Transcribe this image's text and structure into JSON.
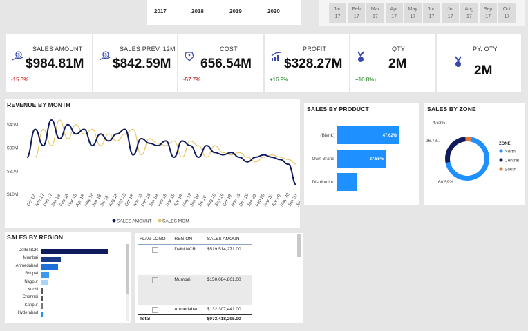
{
  "years": [
    "2017",
    "2018",
    "2019",
    "2020"
  ],
  "months": [
    {
      "m": "Jan",
      "y": "17"
    },
    {
      "m": "Feb",
      "y": "17"
    },
    {
      "m": "Mar",
      "y": "17"
    },
    {
      "m": "Apr",
      "y": "17"
    },
    {
      "m": "May",
      "y": "17"
    },
    {
      "m": "Jun",
      "y": "17"
    },
    {
      "m": "Jul",
      "y": "17"
    },
    {
      "m": "Aug",
      "y": "17"
    },
    {
      "m": "Sep",
      "y": "17"
    },
    {
      "m": "Oct",
      "y": "17"
    }
  ],
  "kpis": [
    {
      "label": "SALES AMOUNT",
      "value": "$984.81M",
      "change": "-15.3%↓",
      "icon": "money-hand-icon"
    },
    {
      "label": "SALES PREV. 12M",
      "value": "$842.59M",
      "change": "",
      "icon": "money-hand-icon"
    },
    {
      "label": "COST",
      "value": "656.54M",
      "change": "-57.7%↓",
      "icon": "tag-icon"
    },
    {
      "label": "PROFIT",
      "value": "$328.27M",
      "change": "+16.9%↑",
      "icon": "growth-chart-icon"
    },
    {
      "label": "QTY",
      "value": "2M",
      "change": "+16.8%↑",
      "icon": "medal-icon"
    },
    {
      "label": "PY. QTY",
      "value": "2M",
      "change": "",
      "icon": "medal-icon"
    }
  ],
  "colors": {
    "navy": "#0f1b5c",
    "gold": "#e8c766",
    "blue": "#1e90ff",
    "orange": "#e07a3c"
  },
  "revenue": {
    "title": "REVENUE BY MONTH",
    "legend": [
      "SALES AMOUNT",
      "SALES MOM"
    ],
    "y_ticks": [
      "$40M",
      "$30M",
      "$20M",
      "$10M"
    ],
    "x_labels": [
      "Oct 17",
      "Nov 17",
      "Dec 17",
      "Jan 18",
      "Feb 18",
      "Mar 18",
      "Apr 18",
      "May 18",
      "Jun 18",
      "Jul 18",
      "Aug 18",
      "Sep 18",
      "Oct 18",
      "Nov 18",
      "Dec 18",
      "Jan 19",
      "Feb 19",
      "Mar 19",
      "Apr 19",
      "May 19",
      "Jun 19",
      "Jul 19",
      "Aug 19",
      "Sep 19",
      "Oct 19",
      "Nov 19",
      "Dec 19",
      "Jan 20",
      "Feb 20",
      "Mar 20",
      "Apr 20",
      "May 20",
      "Jun 20",
      "Jul 20"
    ]
  },
  "chart_data": [
    {
      "type": "line",
      "title": "REVENUE BY MONTH",
      "x": [
        "Oct 17",
        "Nov 17",
        "Dec 17",
        "Jan 18",
        "Feb 18",
        "Mar 18",
        "Apr 18",
        "May 18",
        "Jun 18",
        "Jul 18",
        "Aug 18",
        "Sep 18",
        "Oct 18",
        "Nov 18",
        "Dec 18",
        "Jan 19",
        "Feb 19",
        "Mar 19",
        "Apr 19",
        "May 19",
        "Jun 19",
        "Jul 19",
        "Aug 19",
        "Sep 19",
        "Oct 19",
        "Nov 19",
        "Dec 19",
        "Jan 20",
        "Feb 20",
        "Mar 20",
        "Apr 20",
        "May 20",
        "Jun 20",
        "Jul 20"
      ],
      "series": [
        {
          "name": "SALES AMOUNT",
          "values": [
            26,
            38,
            31,
            42,
            34,
            40,
            36,
            38,
            31,
            36,
            33,
            36,
            38,
            27,
            34,
            32,
            31,
            33,
            26,
            33,
            31,
            26,
            31,
            28,
            27,
            28,
            26,
            24,
            26,
            27,
            26,
            25,
            23,
            14
          ]
        },
        {
          "name": "SALES MOM",
          "values": [
            null,
            26,
            38,
            31,
            42,
            34,
            40,
            36,
            38,
            31,
            36,
            33,
            36,
            38,
            27,
            34,
            32,
            31,
            33,
            26,
            33,
            31,
            26,
            31,
            28,
            27,
            28,
            26,
            24,
            26,
            27,
            26,
            25,
            23
          ]
        }
      ],
      "ylim": [
        10,
        45
      ],
      "legend": "bottom"
    },
    {
      "type": "bar",
      "title": "SALES BY PRODUCT",
      "categories": [
        "(Blank)",
        "Own Brand",
        "Distribution"
      ],
      "values": [
        47.62,
        37.55,
        14.83
      ],
      "labels": [
        "47.62%",
        "37.55%",
        ""
      ]
    },
    {
      "type": "pie",
      "title": "SALES BY ZONE",
      "legend_title": "ZONE",
      "categories": [
        "North",
        "Central",
        "South"
      ],
      "values": [
        68.59,
        26.78,
        4.63
      ],
      "labels": [
        "68.59%",
        "26.78...",
        "4.63%"
      ]
    },
    {
      "type": "bar",
      "title": "SALES BY REGION",
      "categories": [
        "Delhi NCR",
        "Mumbai",
        "Ahmedabad",
        "Bhopal",
        "Nagpur",
        "Kochi",
        "Chennai",
        "Kanpur",
        "Hyderabad"
      ],
      "values": [
        519.5,
        150.1,
        132.3,
        60,
        55,
        12,
        10,
        5,
        4
      ]
    }
  ],
  "product": {
    "title": "SALES BY PRODUCT",
    "rows": [
      {
        "label": "(Blank)",
        "value": 47.62,
        "text": "47.62%"
      },
      {
        "label": "Own Brand",
        "value": 37.55,
        "text": "37.55%"
      },
      {
        "label": "Distribution",
        "value": 14.83,
        "text": ""
      }
    ]
  },
  "zone": {
    "title": "SALES BY ZONE",
    "legend_title": "ZONE",
    "items": [
      {
        "label": "North",
        "value": 68.59,
        "text": "68.59%",
        "color": "#1e90ff"
      },
      {
        "label": "Central",
        "value": 26.78,
        "text": "26.78...",
        "color": "#0f1b5c"
      },
      {
        "label": "South",
        "value": 4.63,
        "text": "4.63%",
        "color": "#e07a3c"
      }
    ]
  },
  "region": {
    "title": "SALES BY REGION",
    "rows": [
      {
        "label": "Delhi NCR",
        "value": 519.5,
        "color": "#0f1b5c"
      },
      {
        "label": "Mumbai",
        "value": 150.1,
        "color": "#1a3a8a"
      },
      {
        "label": "Ahmedabad",
        "value": 132.3,
        "color": "#1e6fd9"
      },
      {
        "label": "Bhopal",
        "value": 60,
        "color": "#3a9af0"
      },
      {
        "label": "Nagpur",
        "value": 55,
        "color": "#a9d3f7"
      },
      {
        "label": "Kochi",
        "value": 12,
        "color": "#555555"
      },
      {
        "label": "Chennai",
        "value": 10,
        "color": "#555555"
      },
      {
        "label": "Kanpur",
        "value": 5,
        "color": "#777777"
      },
      {
        "label": "Hyderabad",
        "value": 4,
        "color": "#1e90ff"
      }
    ]
  },
  "table": {
    "headers": [
      "FLAG LOGO",
      "REGION",
      "SALES AMOUNT"
    ],
    "rows": [
      {
        "region": "Delhi NCR",
        "amount": "$519,514,271.00"
      },
      {
        "region": "Mumbai",
        "amount": "$150,084,801.00"
      },
      {
        "region": "Ahmedabad",
        "amount": "$132,307,441.00"
      }
    ],
    "total_label": "Total",
    "total_amount": "$973,418,295.00"
  }
}
